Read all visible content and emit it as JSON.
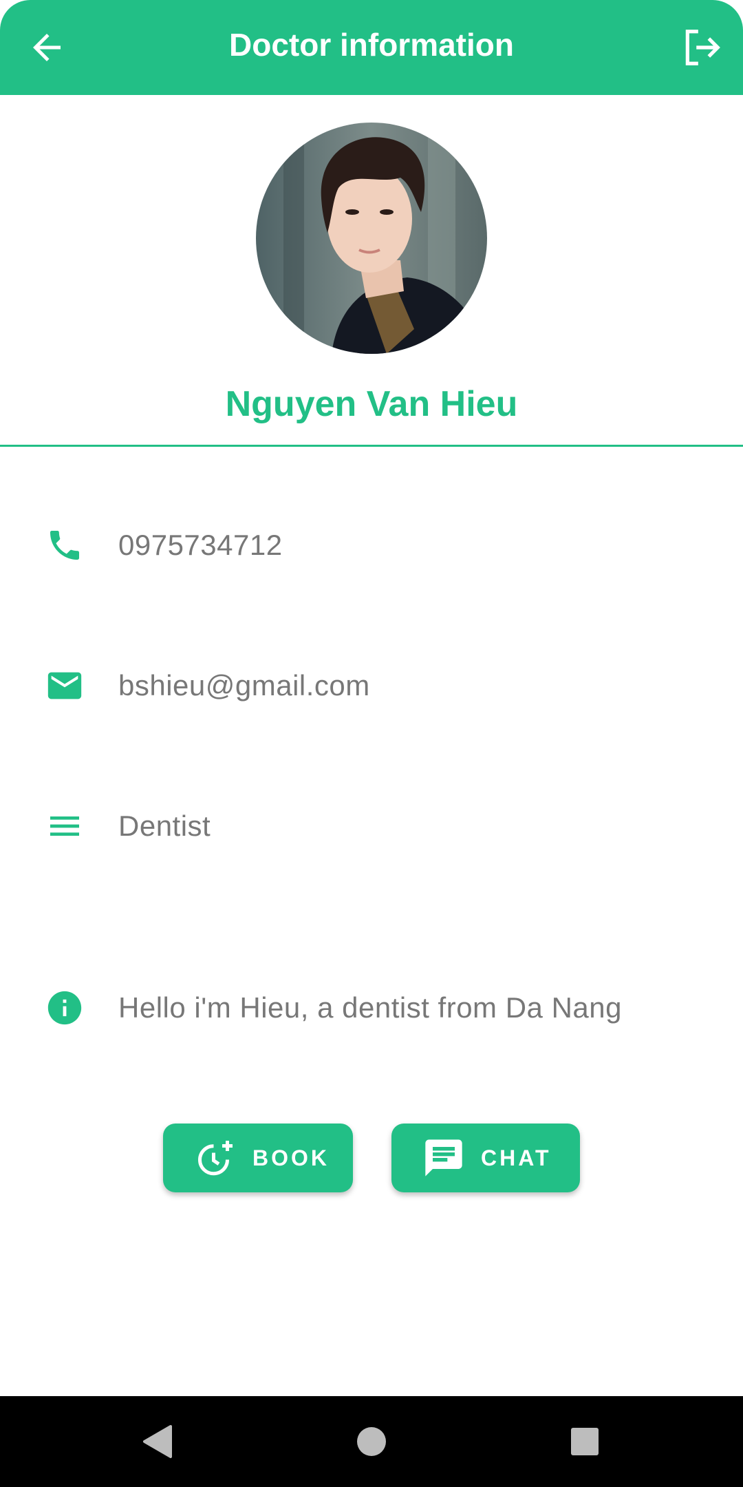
{
  "header": {
    "title": "Doctor information",
    "back_icon": "arrow-left-icon",
    "logout_icon": "logout-icon"
  },
  "profile": {
    "avatar": "doctor-portrait",
    "name": "Nguyen Van Hieu"
  },
  "info": {
    "phone": "0975734712",
    "email": "bshieu@gmail.com",
    "specialty": "Dentist",
    "about": "Hello i'm Hieu, a dentist from Da Nang"
  },
  "actions": {
    "book_label": "BOOK",
    "chat_label": "CHAT"
  },
  "colors": {
    "accent": "#22bf86",
    "text_muted": "#777777",
    "navbar": "#000000"
  },
  "navbar": {
    "back_icon": "triangle-back-icon",
    "home_icon": "circle-home-icon",
    "recent_icon": "square-recents-icon"
  }
}
